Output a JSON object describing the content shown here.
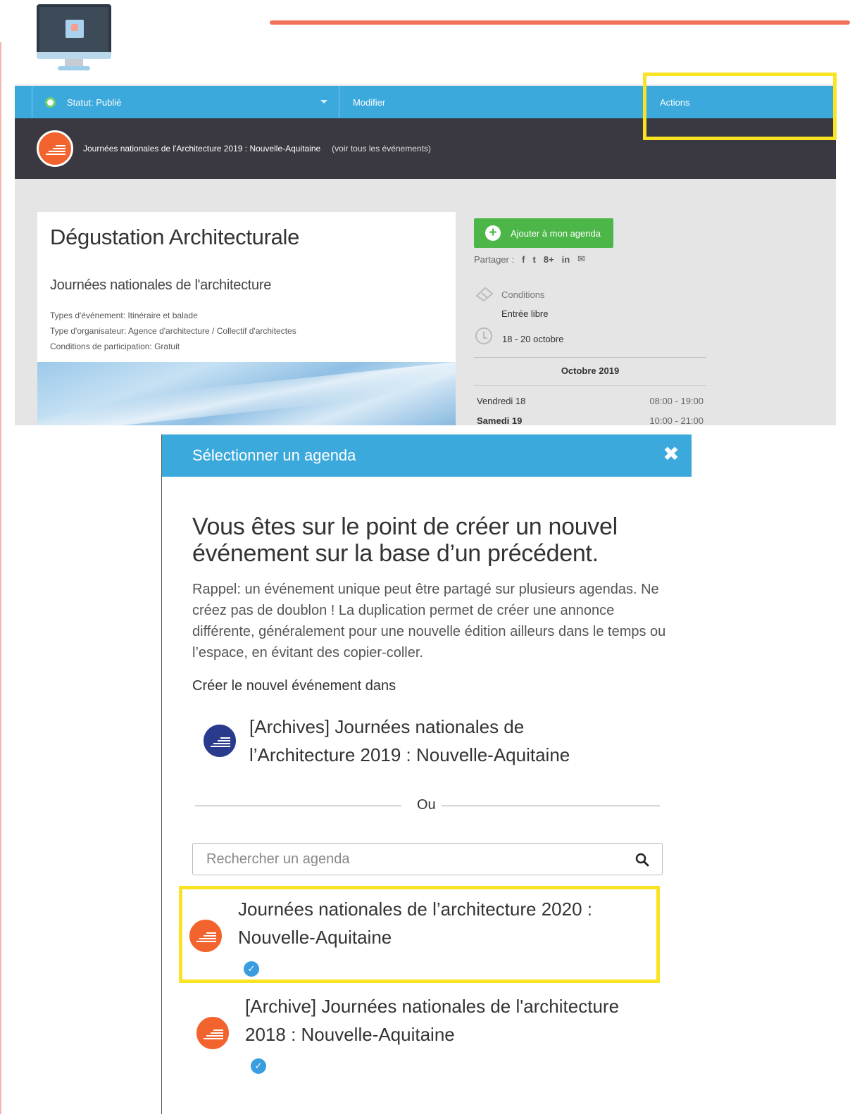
{
  "status_bar": {
    "status": "Statut: Publié",
    "modify": "Modifier",
    "actions": "Actions"
  },
  "title_bar": {
    "event_title": "Journées nationales de l'Architecture 2019 : Nouvelle-Aquitaine",
    "see_all": "(voir tous les événements)"
  },
  "event": {
    "title": "Dégustation Architecturale",
    "subtitle": "Journées nationales de l'architecture",
    "meta": [
      "Types d'événement: Itinéraire et balade",
      "Type d'organisateur: Agence d'architecture / Collectif d'architectes",
      "Conditions de participation: Gratuit"
    ]
  },
  "sidebar": {
    "add_button": "Ajouter à mon agenda",
    "share_label": "Partager :",
    "share_icons": [
      "f",
      "t",
      "8+",
      "in",
      "✉"
    ],
    "conditions_label": "Conditions",
    "conditions_value": "Entrée libre",
    "dates": "18 - 20 octobre",
    "month": "Octobre 2019",
    "days": [
      {
        "day": "Vendredi 18",
        "time": "08:00 - 19:00"
      },
      {
        "day": "Samedi 19",
        "time": "10:00 - 21:00"
      }
    ]
  },
  "modal": {
    "title": "Sélectionner un agenda",
    "heading": "Vous êtes sur le point de créer un nouvel événement sur la base d’un précédent.",
    "reminder": "Rappel: un événement unique peut être partagé sur plusieurs agendas. Ne créez pas de doublon ! La duplication permet de créer une annonce différente, généralement pour une nouvelle édition ailleurs dans le temps ou l’espace, en évitant des copier-coller.",
    "create_in": "Créer le nouvel événement dans",
    "current_agenda_line1": "[Archives] Journées nationales de",
    "current_agenda_line2": "l’Architecture 2019 : Nouvelle-Aquitaine",
    "or": "Ou",
    "search_placeholder": "Rechercher un agenda",
    "results": [
      {
        "line1": "Journées nationales de l’architecture 2020 :",
        "line2": "Nouvelle-Aquitaine"
      },
      {
        "line1": "[Archive] Journées nationales de l'architecture",
        "line2": "2018 : Nouvelle-Aquitaine"
      }
    ]
  },
  "colors": {
    "accent_blue": "#3ba9dc",
    "green": "#4cb748",
    "dark_bar": "#3a3840",
    "highlight_yellow": "#f9e322",
    "brand_orange": "#f2632d"
  }
}
